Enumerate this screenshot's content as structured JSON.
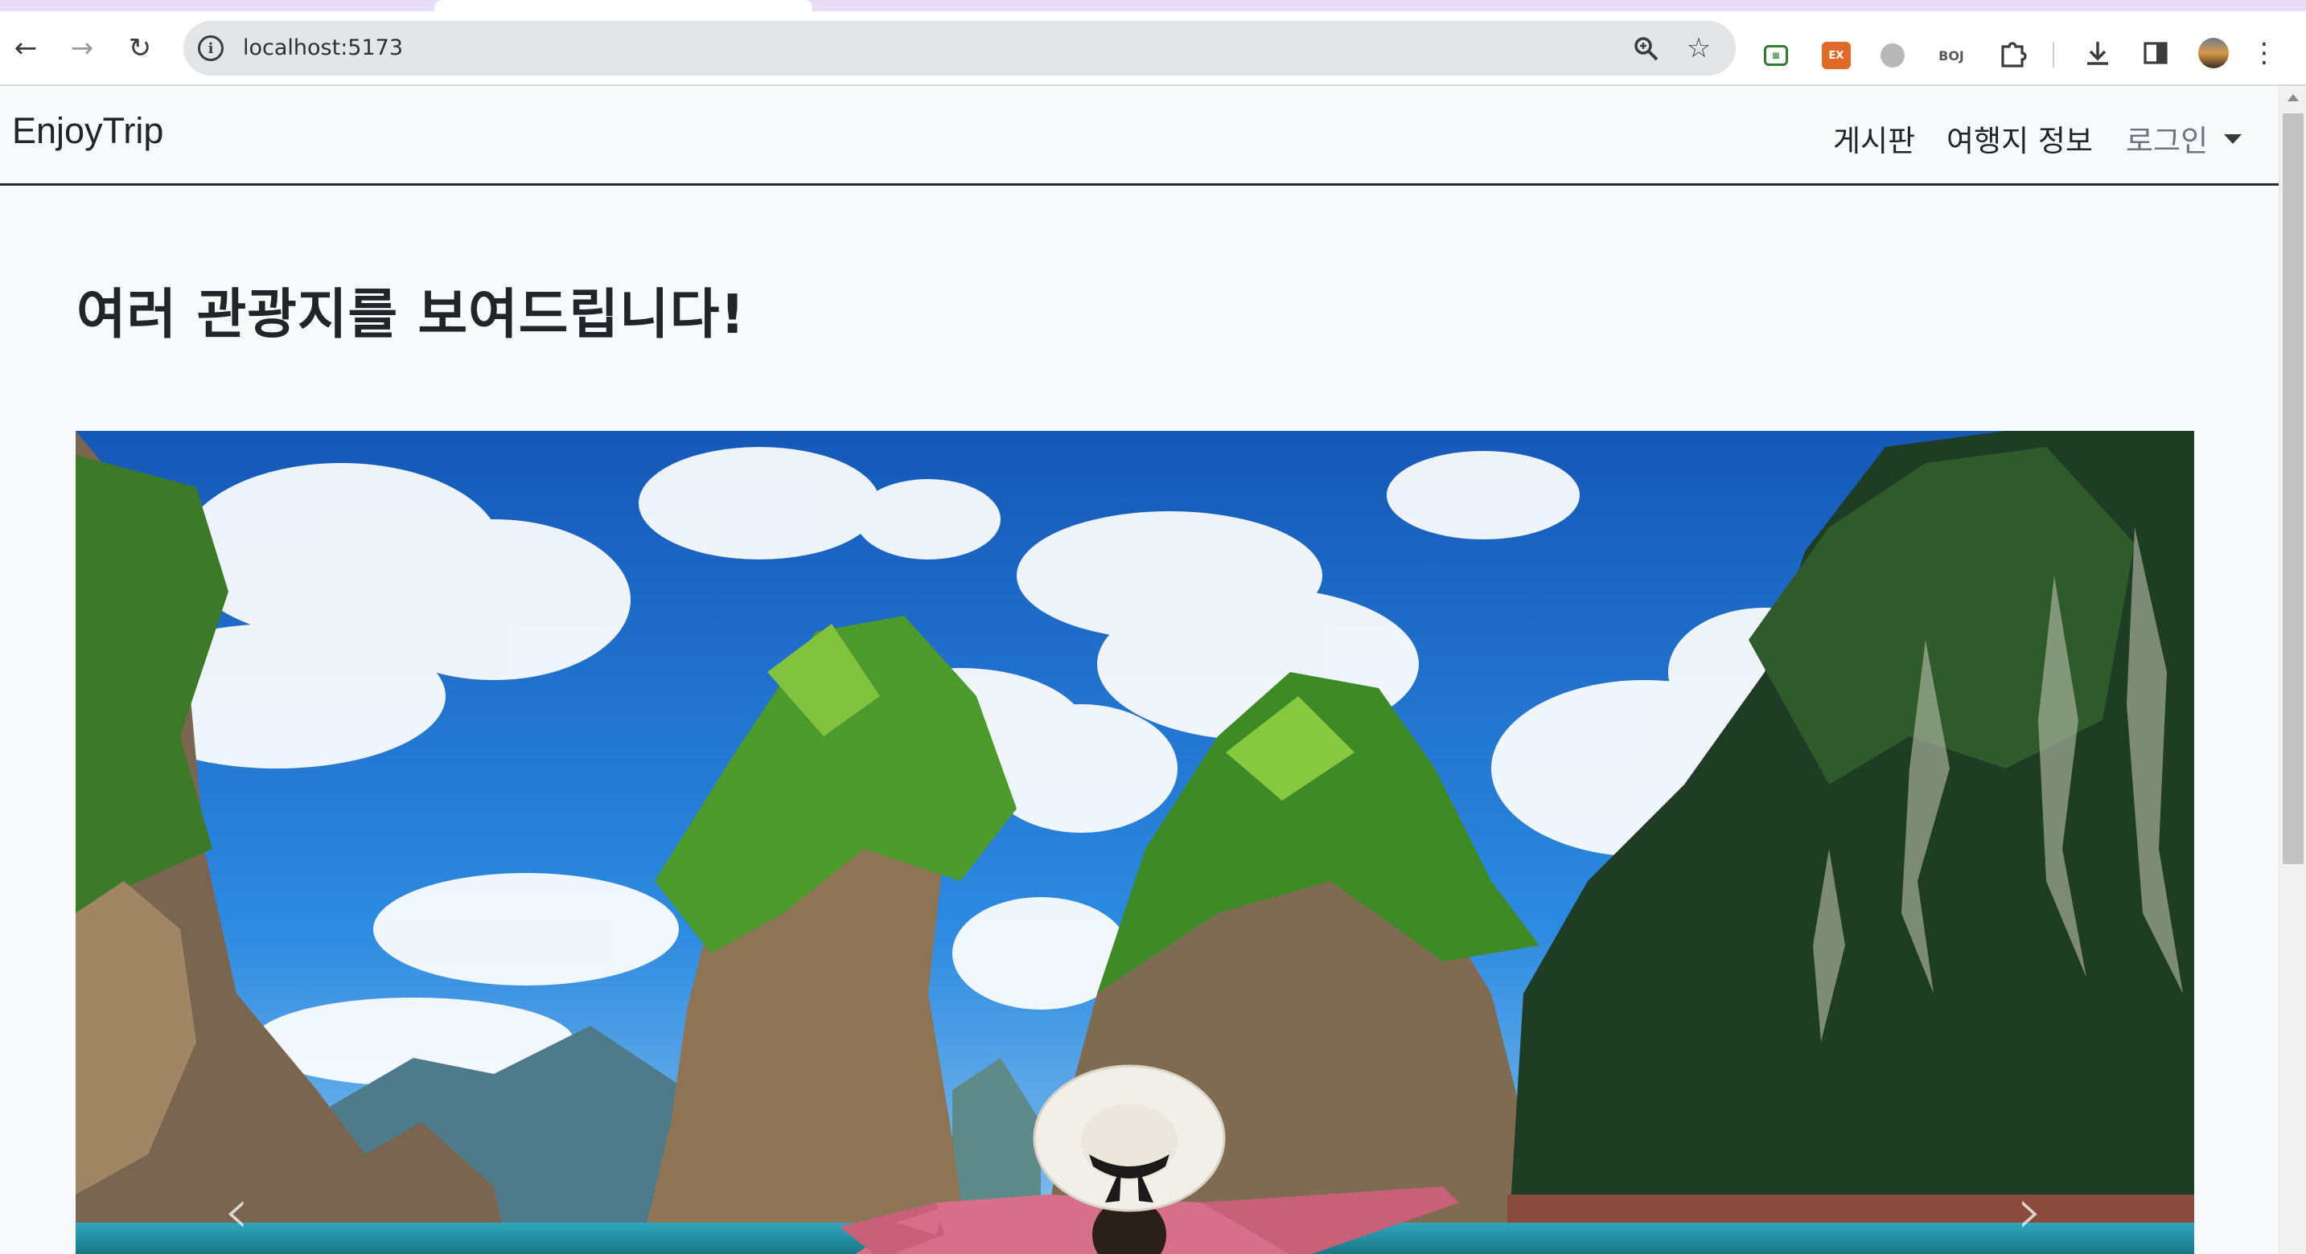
{
  "browser": {
    "url": "localhost:5173",
    "icons": {
      "back": "arrow-left-icon",
      "forward": "arrow-right-icon",
      "reload": "reload-icon",
      "site_info": "info-icon",
      "zoom": "zoom-icon",
      "bookmark": "star-icon",
      "extensions": "puzzle-icon",
      "downloads": "download-icon",
      "side_panel": "side-panel-icon",
      "menu": "kebab-menu-icon"
    },
    "extensions": [
      {
        "name": "green-extension-icon",
        "label": "",
        "color": "#2e7d32"
      },
      {
        "name": "ex-extension-icon",
        "label": "EX",
        "color": "#e06a2a"
      },
      {
        "name": "gray-extension-icon",
        "label": "",
        "color": "#9e9e9e"
      },
      {
        "name": "boj-extension-icon",
        "label": "BOJ",
        "color": "#5a5a5a"
      }
    ]
  },
  "navbar": {
    "brand": "EnjoyTrip",
    "links": {
      "board": "게시판",
      "travel_info": "여행지 정보",
      "login": "로그인"
    }
  },
  "main": {
    "headline": "여러 관광지를 보여드립니다!"
  },
  "carousel": {
    "prev_icon": "chevron-left-icon",
    "next_icon": "chevron-right-icon",
    "colors": {
      "sky": "#1e72c8",
      "cloud": "#ffffff",
      "rock": "#8a7458",
      "foliage": "#3f8a2a",
      "cliff": "#1d3a22",
      "water": "#2a9bb0",
      "shirt": "#d6708a"
    }
  }
}
